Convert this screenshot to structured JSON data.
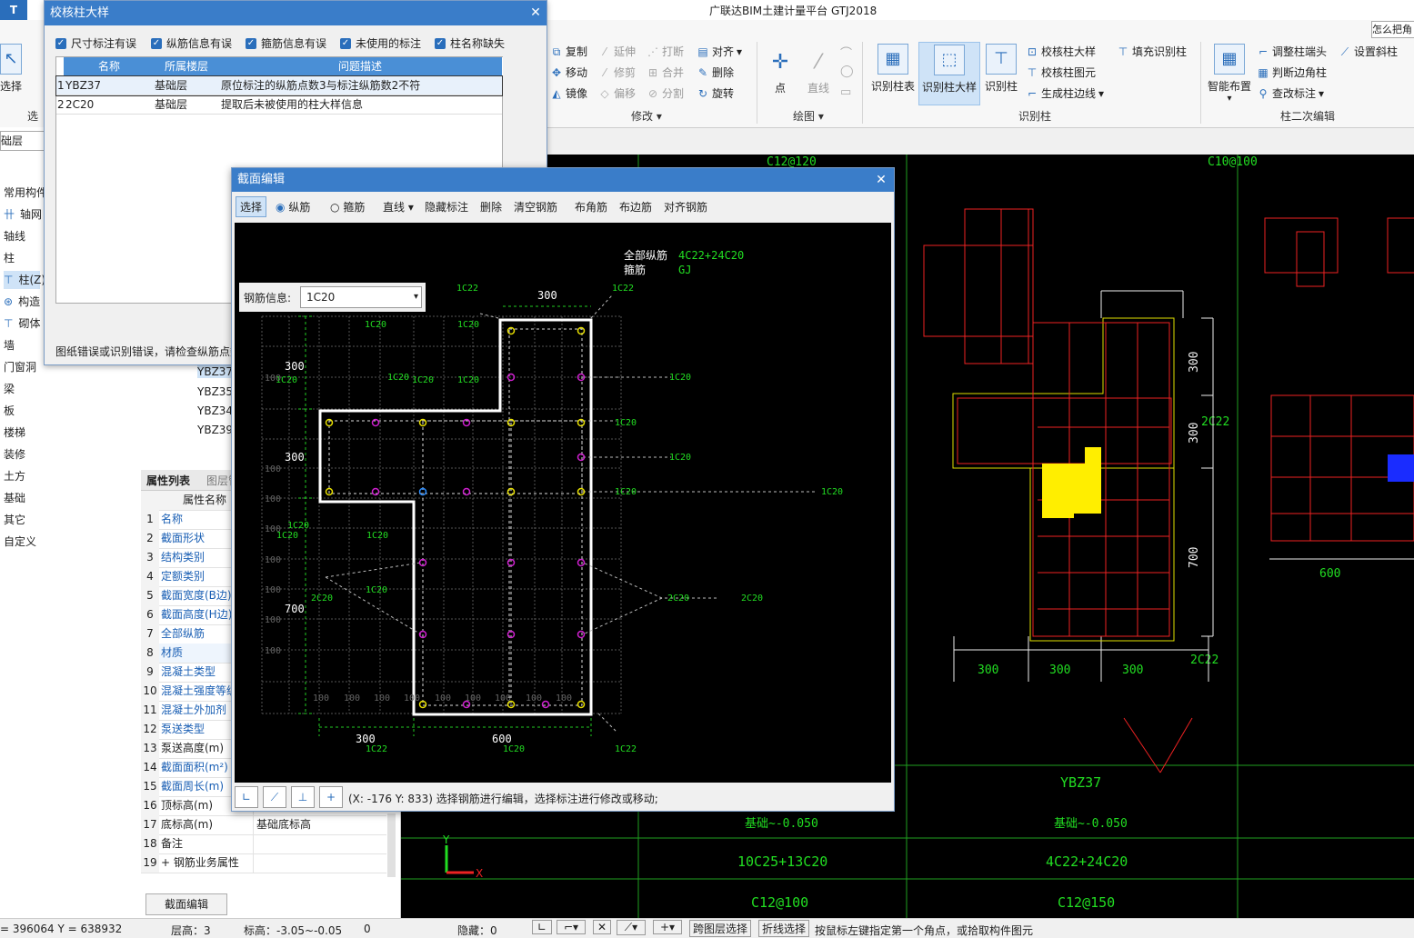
{
  "app": {
    "title": "广联达BIM土建计量平台 GTJ2018",
    "help_placeholder": "怎么把角"
  },
  "ribbon": {
    "left_partial": {
      "select_label": "选择",
      "select_group": "选"
    },
    "modify": {
      "copy": "复制",
      "move": "移动",
      "mirror": "镜像",
      "extend": "延伸",
      "trim": "修剪",
      "offset": "偏移",
      "break": "打断",
      "merge": "合并",
      "split": "分割",
      "align": "对齐",
      "delete": "删除",
      "rotate": "旋转",
      "group": "修改"
    },
    "draw": {
      "point": "点",
      "line": "直线",
      "group": "绘图"
    },
    "recognize": {
      "table": "识别柱表",
      "detail": "识别柱大样",
      "column": "识别柱",
      "check_detail": "校核柱大样",
      "check_elem": "校核柱图元",
      "gen_edge": "生成柱边线",
      "fill": "填充识别柱",
      "group": "识别柱"
    },
    "secondary": {
      "smart": "智能布置",
      "adjust_end": "调整柱端头",
      "judge_corner": "判断边角柱",
      "view_label": "查改标注",
      "set_slope": "设置斜柱",
      "group": "柱二次编辑"
    }
  },
  "leftnav": {
    "floor": "础层",
    "items": [
      "常用构件",
      "轴网",
      "轴线",
      "柱",
      "柱(Z)",
      "构造",
      "砌体",
      "墙",
      "门窗洞",
      "梁",
      "板",
      "楼梯",
      "装修",
      "土方",
      "基础",
      "其它",
      "自定义"
    ]
  },
  "midpanel": {
    "ybz_list": [
      "YBZ37",
      "YBZ35",
      "YBZ34",
      "YBZ39"
    ],
    "tabs": [
      "属性列表",
      "图层管"
    ],
    "header": "属性名称",
    "rows": [
      {
        "no": "1",
        "name": "名称",
        "value": "",
        "link": true
      },
      {
        "no": "2",
        "name": "截面形状",
        "value": "",
        "link": true
      },
      {
        "no": "3",
        "name": "结构类别",
        "value": "",
        "link": true
      },
      {
        "no": "4",
        "name": "定额类别",
        "value": "",
        "link": true
      },
      {
        "no": "5",
        "name": "截面宽度(B边)",
        "value": "",
        "link": true
      },
      {
        "no": "6",
        "name": "截面高度(H边)",
        "value": "",
        "link": true
      },
      {
        "no": "7",
        "name": "全部纵筋",
        "value": "",
        "link": true
      },
      {
        "no": "8",
        "name": "材质",
        "value": "",
        "link": true
      },
      {
        "no": "9",
        "name": "混凝土类型",
        "value": "",
        "link": true
      },
      {
        "no": "10",
        "name": "混凝土强度等级",
        "value": "",
        "link": true
      },
      {
        "no": "11",
        "name": "混凝土外加剂",
        "value": "",
        "link": true
      },
      {
        "no": "12",
        "name": "泵送类型",
        "value": "",
        "link": true
      },
      {
        "no": "13",
        "name": "泵送高度(m)",
        "value": "",
        "link": false
      },
      {
        "no": "14",
        "name": "截面面积(m²)",
        "value": "",
        "link": true
      },
      {
        "no": "15",
        "name": "截面周长(m)",
        "value": "",
        "link": true
      },
      {
        "no": "16",
        "name": "顶标高(m)",
        "value": "",
        "link": false
      },
      {
        "no": "17",
        "name": "底标高(m)",
        "value": "基础底标高",
        "link": false
      },
      {
        "no": "18",
        "name": "备注",
        "value": "",
        "link": false
      },
      {
        "no": "19",
        "name": "+ 钢筋业务属性",
        "value": "",
        "link": false
      }
    ],
    "edit_button": "截面编辑"
  },
  "dialog_check": {
    "title": "校核柱大样",
    "checks": [
      "尺寸标注有误",
      "纵筋信息有误",
      "箍筋信息有误",
      "未使用的标注",
      "柱名称缺失"
    ],
    "columns": [
      "名称",
      "所属楼层",
      "问题描述"
    ],
    "rows": [
      {
        "no": "1",
        "name": "YBZ37",
        "floor": "基础层",
        "desc": "原位标注的纵筋点数3与标注纵筋数2不符"
      },
      {
        "no": "2",
        "name": "2C20",
        "floor": "基础层",
        "desc": "提取后未被使用的柱大样信息"
      }
    ],
    "message": "图纸错误或识别错误，请检查纵筋点数"
  },
  "dialog_section": {
    "title": "截面编辑",
    "toolbar": {
      "select": "选择",
      "long": "纵筋",
      "stirrup": "箍筋",
      "line": "直线",
      "hide": "隐藏标注",
      "delete": "删除",
      "clear": "清空钢筋",
      "corner": "布角筋",
      "edge": "布边筋",
      "align": "对齐钢筋"
    },
    "rebar_info_label": "钢筋信息:",
    "rebar_info_value": "1C20",
    "canvas": {
      "all_long_label": "全部纵筋",
      "all_long_value": "4C22+24C20",
      "stirrup_label": "箍筋",
      "stirrup_value": "GJ",
      "dims": {
        "top": "300",
        "left_300a": "300",
        "left_300b": "300",
        "left_700": "700",
        "bottom_300": "300",
        "bottom_600": "600"
      },
      "labels": {
        "c22": "1C22",
        "c20": "1C20",
        "c2_20": "2C20",
        "g100": "100"
      }
    },
    "status": "(X: -176 Y: 833)  选择钢筋进行编辑，选择标注进行修改或移动;"
  },
  "cad": {
    "texts": {
      "c12_120": "C12@120",
      "c10_100": "C10@100",
      "dim300": "300",
      "dim700": "700",
      "dim600": "600",
      "c2_22": "2C22",
      "ybz37": "YBZ37",
      "elev1": "基础~-0.050",
      "elev2": "基础~-0.050",
      "bars1": "10C25+13C20",
      "bars2": "4C22+24C20",
      "st1": "C12@100",
      "st2": "C12@150"
    }
  },
  "statusbar": {
    "coords": "= 396064 Y = 638932",
    "floor_h": "层高：3",
    "elev": "标高：-3.05~-0.05",
    "zero": "0",
    "hidden": "隐藏：0",
    "cross_layer": "跨图层选择",
    "polyline": "折线选择",
    "hint": "按鼠标左键指定第一个角点，或拾取构件图元"
  }
}
